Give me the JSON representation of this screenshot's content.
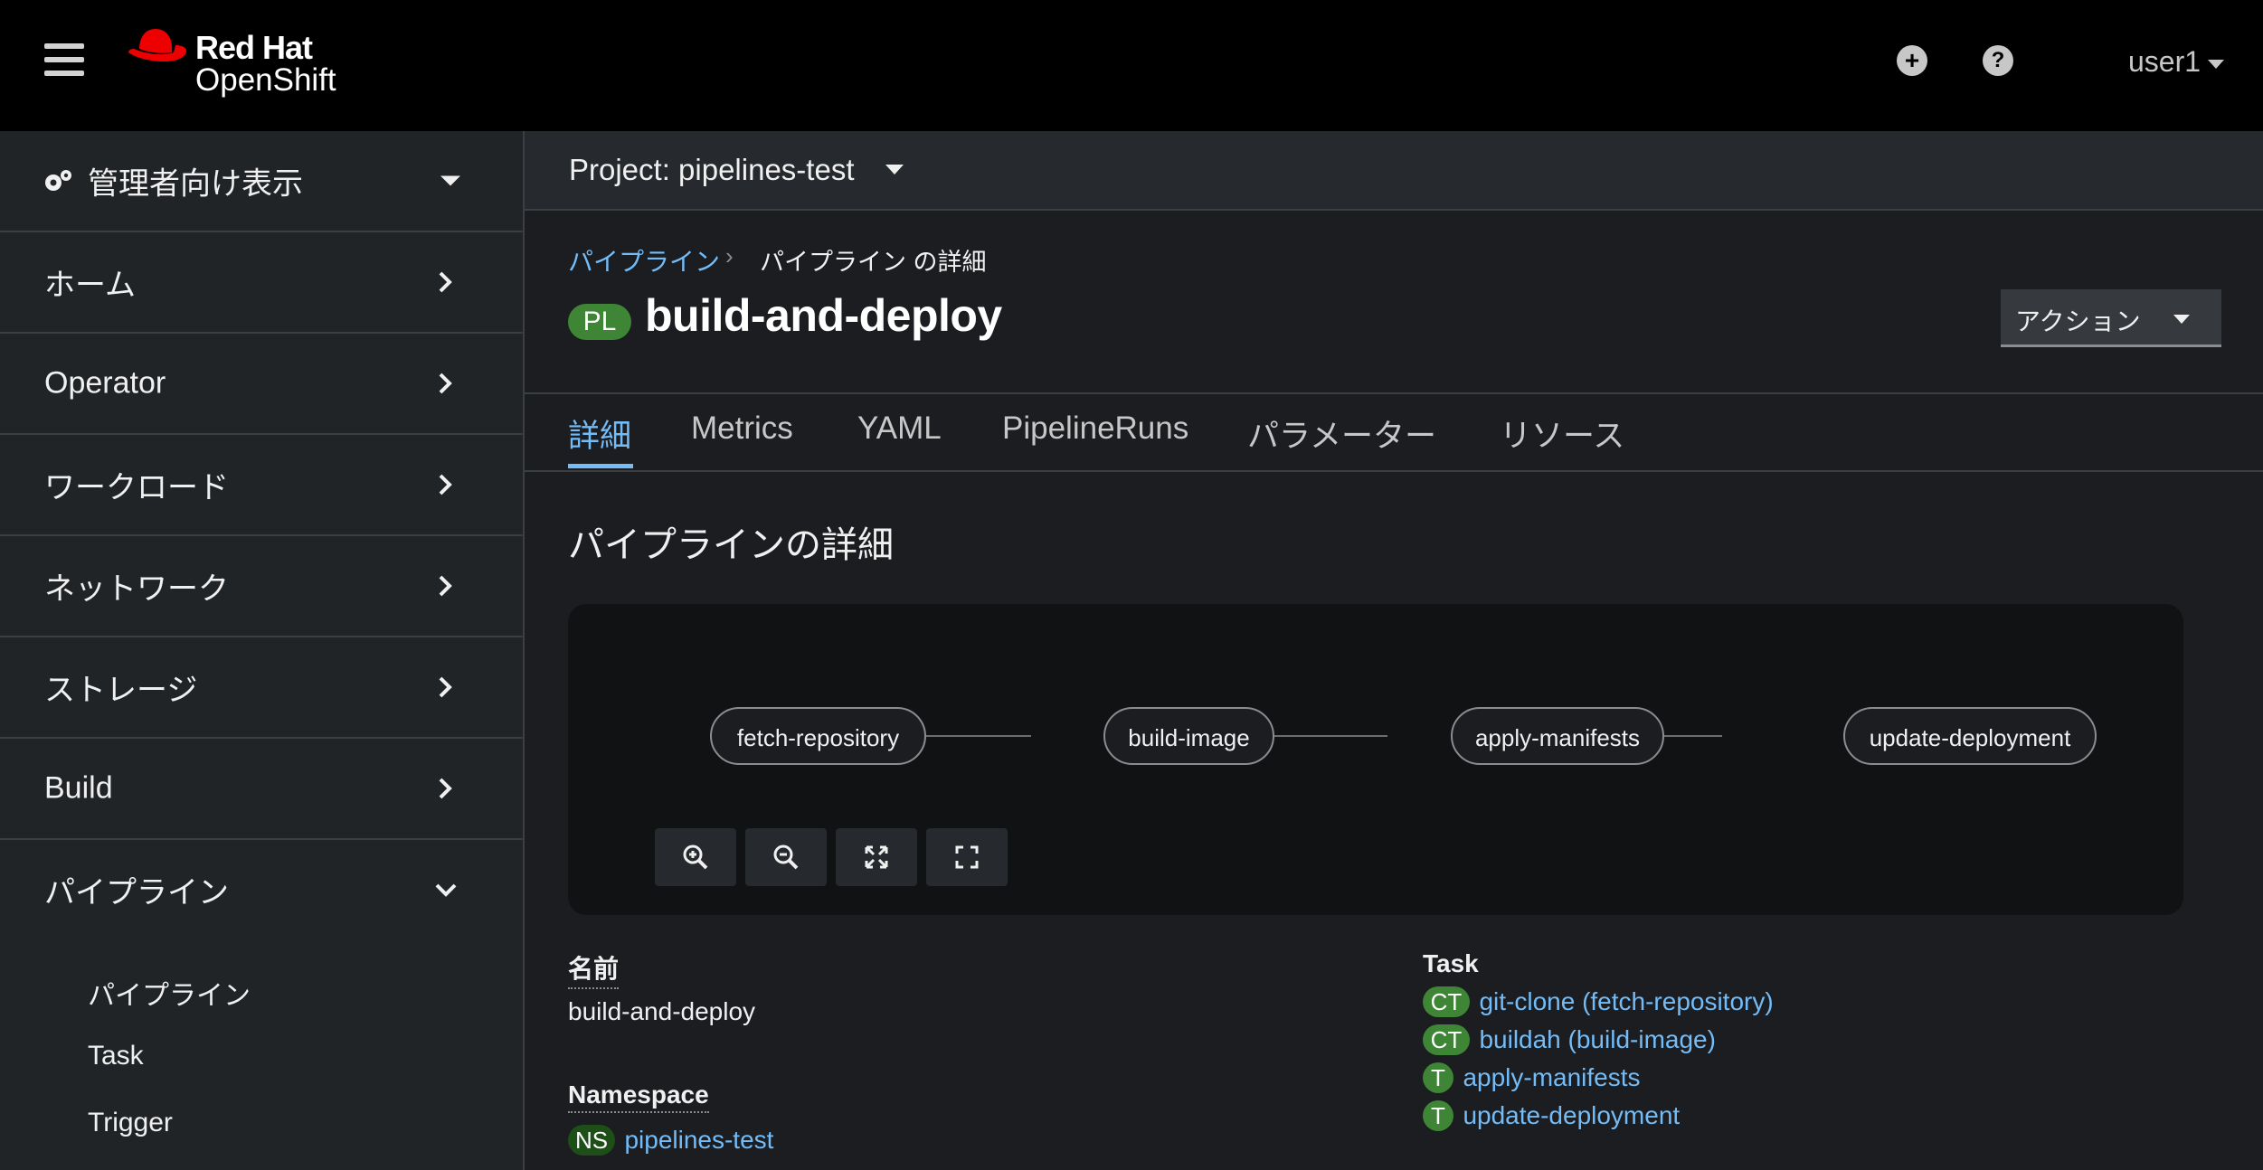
{
  "masthead": {
    "brand_line1": "Red Hat",
    "brand_line2": "OpenShift",
    "icons": [
      "menu-icon",
      "add-icon",
      "help-icon"
    ],
    "user": "user1"
  },
  "sidebar": {
    "perspective": "管理者向け表示",
    "items": [
      {
        "label": "ホーム"
      },
      {
        "label": "Operator"
      },
      {
        "label": "ワークロード"
      },
      {
        "label": "ネットワーク"
      },
      {
        "label": "ストレージ"
      },
      {
        "label": "Build"
      },
      {
        "label": "パイプライン"
      }
    ],
    "subitems": [
      {
        "label": "パイプライン"
      },
      {
        "label": "Task"
      },
      {
        "label": "Trigger"
      }
    ]
  },
  "project": {
    "label": "Project: pipelines-test"
  },
  "breadcrumb": {
    "parent": "パイプライン",
    "separator": "›",
    "current": "パイプライン の詳細"
  },
  "header": {
    "badge": "PL",
    "title": "build-and-deploy",
    "actions_label": "アクション"
  },
  "tabs": [
    {
      "label": "詳細"
    },
    {
      "label": "Metrics"
    },
    {
      "label": "YAML"
    },
    {
      "label": "PipelineRuns"
    },
    {
      "label": "パラメーター"
    },
    {
      "label": "リソース"
    }
  ],
  "details": {
    "section_title": "パイプラインの詳細",
    "graph_nodes": [
      {
        "label": "fetch-repository"
      },
      {
        "label": "build-image"
      },
      {
        "label": "apply-manifests"
      },
      {
        "label": "update-deployment"
      }
    ],
    "name_label": "名前",
    "name_value": "build-and-deploy",
    "namespace_label": "Namespace",
    "namespace_badge": "NS",
    "namespace_value": "pipelines-test",
    "task_label": "Task",
    "tasks": [
      {
        "badge": "CT",
        "label": "git-clone (fetch-repository)"
      },
      {
        "badge": "CT",
        "label": "buildah (build-image)"
      },
      {
        "badge": "T",
        "label": "apply-manifests"
      },
      {
        "badge": "T",
        "label": "update-deployment"
      }
    ]
  },
  "colors": {
    "accent": "#73bcf7",
    "badge_green": "#3e8635",
    "masthead": "#000000",
    "sidebar": "#212427",
    "background": "#1b1d21"
  }
}
